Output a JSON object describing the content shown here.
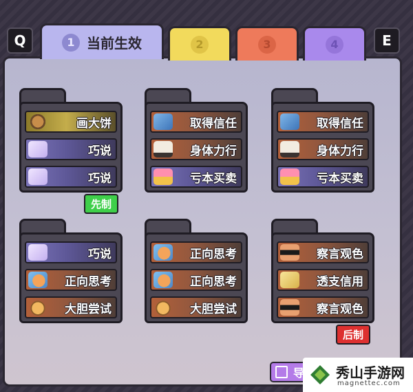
{
  "keys": {
    "left": "Q",
    "right": "E"
  },
  "tabs": [
    {
      "num": "1",
      "label": "当前生效",
      "color": "#b9b6ee"
    },
    {
      "num": "2",
      "label": "",
      "color": "#f2da5c"
    },
    {
      "num": "3",
      "label": "",
      "color": "#ee7a5b"
    },
    {
      "num": "4",
      "label": "",
      "color": "#a989ec"
    }
  ],
  "cards": [
    {
      "items": [
        {
          "label": "画大饼",
          "icon": "pie-icon",
          "style": "gold"
        },
        {
          "label": "巧说",
          "icon": "talk-icon",
          "style": "purple"
        },
        {
          "label": "巧说",
          "icon": "talk-icon",
          "style": "purple"
        }
      ],
      "badge": "先制"
    },
    {
      "items": [
        {
          "label": "取得信任",
          "icon": "handshake-icon",
          "style": "orange"
        },
        {
          "label": "身体力行",
          "icon": "presentation-icon",
          "style": "orange"
        },
        {
          "label": "亏本买卖",
          "icon": "gift-box-icon",
          "style": "purple"
        }
      ]
    },
    {
      "items": [
        {
          "label": "取得信任",
          "icon": "handshake-icon",
          "style": "orange"
        },
        {
          "label": "身体力行",
          "icon": "presentation-icon",
          "style": "orange"
        },
        {
          "label": "亏本买卖",
          "icon": "gift-box-icon",
          "style": "purple"
        }
      ]
    },
    {
      "items": [
        {
          "label": "巧说",
          "icon": "talk-icon",
          "style": "purple"
        },
        {
          "label": "正向思考",
          "icon": "thinking-icon",
          "style": "orange"
        },
        {
          "label": "大胆尝试",
          "icon": "bold-try-icon",
          "style": "orange"
        }
      ]
    },
    {
      "items": [
        {
          "label": "正向思考",
          "icon": "thinking-icon",
          "style": "orange"
        },
        {
          "label": "正向思考",
          "icon": "thinking-icon",
          "style": "orange"
        },
        {
          "label": "大胆尝试",
          "icon": "bold-try-icon",
          "style": "orange"
        }
      ]
    },
    {
      "items": [
        {
          "label": "察言观色",
          "icon": "sunglasses-icon",
          "style": "orange"
        },
        {
          "label": "透支信用",
          "icon": "credit-card-icon",
          "style": "orange"
        },
        {
          "label": "察言观色",
          "icon": "sunglasses-icon",
          "style": "orange"
        }
      ],
      "badge": "后制"
    }
  ],
  "badges": {
    "first": "先制",
    "last": "后制"
  },
  "bottom": {
    "import_label": "导",
    "site_name": "秀山手游网",
    "site_domain": "magnettec.com"
  },
  "colors": {
    "badge_first": "#3fcf4a",
    "badge_last": "#dd3030"
  }
}
